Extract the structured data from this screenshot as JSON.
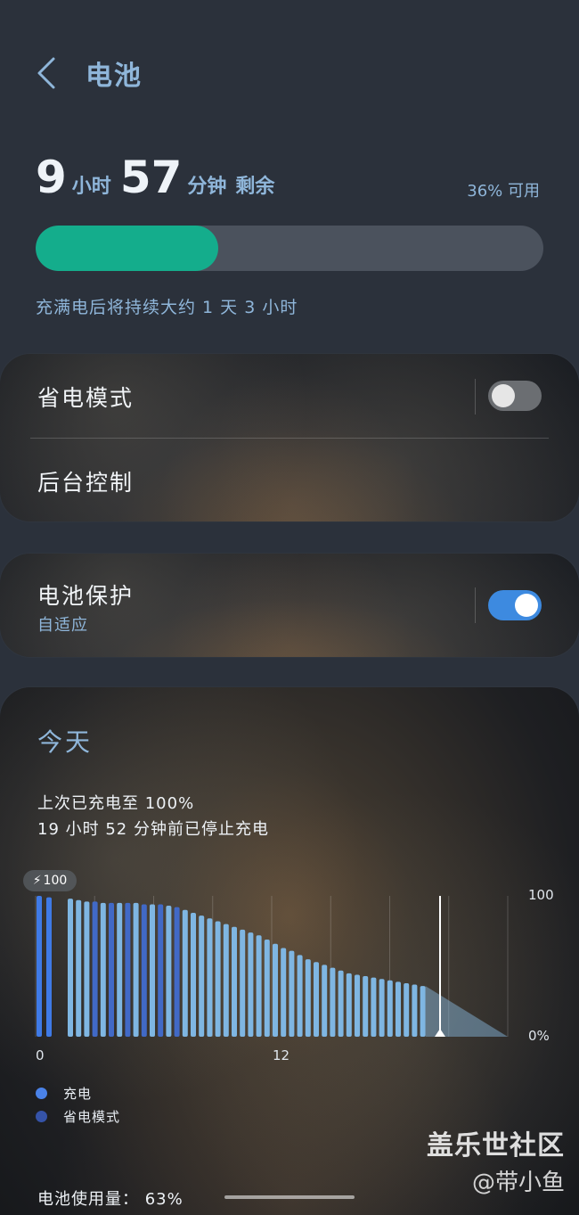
{
  "header": {
    "title": "电池"
  },
  "battery": {
    "hours": "9",
    "hours_unit": "小时",
    "minutes": "57",
    "minutes_unit": "分钟",
    "remaining_word": "剩余",
    "available": "36% 可用",
    "level_percent": 36,
    "full_charge_note": "充满电后将持续大约 1 天 3 小时"
  },
  "settings": {
    "power_saving": {
      "label": "省电模式",
      "enabled": false
    },
    "background_control": {
      "label": "后台控制"
    },
    "battery_protection": {
      "label": "电池保护",
      "sublabel": "自适应",
      "enabled": true
    }
  },
  "today": {
    "title": "今天",
    "last_charged": "上次已充电至 100%",
    "stopped_charging": "19 小时 52 分钟前已停止充电",
    "badge_value": "100",
    "usage": "电池使用量： 63%"
  },
  "chart_data": {
    "type": "bar",
    "y_max_label": "100",
    "y_min_label": "0%",
    "x_tick_labels": [
      "0",
      "12"
    ],
    "legend": [
      {
        "label": "充电",
        "color": "#4a82e8"
      },
      {
        "label": "省电模式",
        "color": "#3553a8"
      }
    ],
    "values": [
      100,
      99,
      98,
      97,
      96,
      96,
      95,
      95,
      95,
      95,
      95,
      94,
      94,
      94,
      93,
      92,
      90,
      88,
      86,
      84,
      82,
      80,
      78,
      76,
      74,
      72,
      69,
      66,
      63,
      61,
      58,
      55,
      53,
      51,
      49,
      47,
      45,
      44,
      43,
      42,
      41,
      40,
      39,
      38,
      37,
      36
    ],
    "ylim": [
      0,
      100
    ]
  },
  "colors": {
    "accent": "#8fb6da",
    "progress": "#14ad8c",
    "toggle_on": "#3d8ae0"
  },
  "watermark": {
    "line1": "盖乐世社区",
    "line2": "@带小鱼"
  }
}
